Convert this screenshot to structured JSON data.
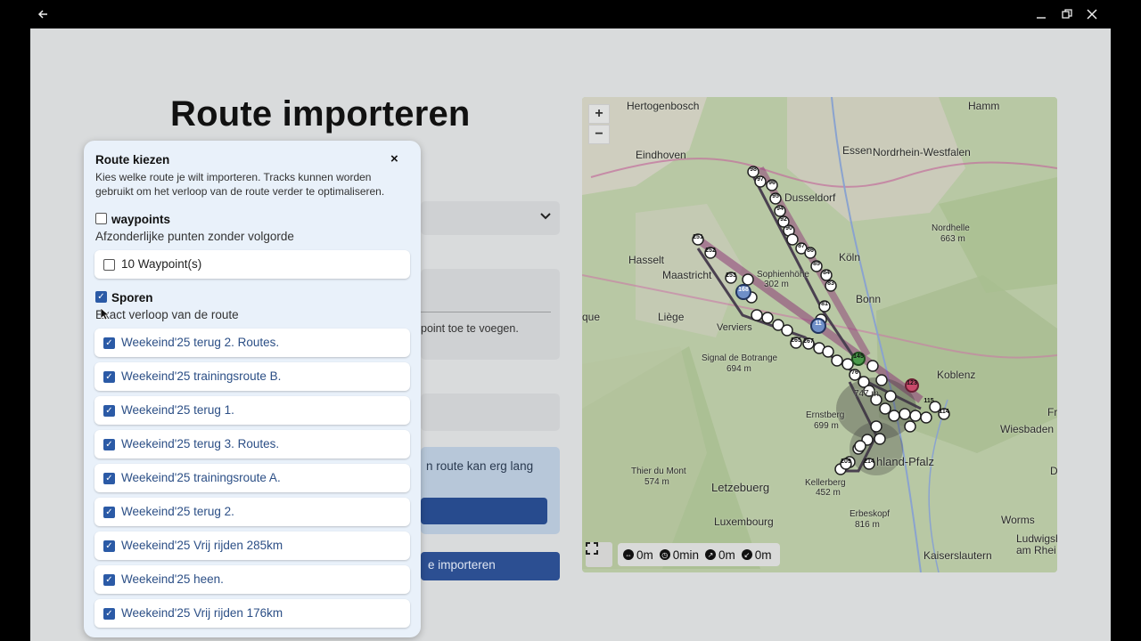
{
  "window": {
    "back_icon": "arrow-left-icon",
    "minimize": "minimize-icon",
    "maximize": "restore-icon",
    "close": "close-icon"
  },
  "page": {
    "title": "Route importeren",
    "bg_hint": "point toe te voegen.",
    "bg_info": "n route kan erg lang",
    "bg_import_label": "e importeren"
  },
  "map": {
    "zoom_in": "+",
    "zoom_out": "−",
    "labels": [
      {
        "text": "Hertogenbosch"
      },
      {
        "text": "Hamm"
      },
      {
        "text": "Eindhoven"
      },
      {
        "text": "Essen"
      },
      {
        "text": "Nordrhein-Westfalen"
      },
      {
        "text": "Dusseldorf"
      },
      {
        "text": "Nordhelle"
      },
      {
        "text": "663 m"
      },
      {
        "text": "Hasselt"
      },
      {
        "text": "Maastricht"
      },
      {
        "text": "Sophienhöhe"
      },
      {
        "text": "302 m"
      },
      {
        "text": "Köln"
      },
      {
        "text": "Bonn"
      },
      {
        "text": "que"
      },
      {
        "text": "Liège"
      },
      {
        "text": "Verviers"
      },
      {
        "text": "Signal de Botrange"
      },
      {
        "text": "694 m"
      },
      {
        "text": "Koblenz"
      },
      {
        "text": "Ernstberg"
      },
      {
        "text": "699 m"
      },
      {
        "text": "747 m"
      },
      {
        "text": "Wiesbaden"
      },
      {
        "text": "Fr"
      },
      {
        "text": "Thier du Mont"
      },
      {
        "text": "574 m"
      },
      {
        "text": "Letzebuerg"
      },
      {
        "text": "Kellerberg"
      },
      {
        "text": "452 m"
      },
      {
        "text": "hland-Pfalz"
      },
      {
        "text": "Da"
      },
      {
        "text": "Luxembourg"
      },
      {
        "text": "Erbeskopf"
      },
      {
        "text": "816 m"
      },
      {
        "text": "Worms"
      },
      {
        "text": "Ludwigsha"
      },
      {
        "text": "am Rhei"
      },
      {
        "text": "Kaiserslautern"
      }
    ],
    "markers": [
      "98",
      "97",
      "96",
      "95",
      "94",
      "92",
      "90",
      "87",
      "86",
      "85",
      "84",
      "83",
      "81",
      "251",
      "252",
      "253",
      "168",
      "11",
      "265",
      "267",
      "145",
      "76",
      "123",
      "115",
      "114",
      "209",
      "214"
    ],
    "stats": [
      {
        "icon": "distance-icon",
        "value": "0m"
      },
      {
        "icon": "clock-icon",
        "value": "0min"
      },
      {
        "icon": "ascent-icon",
        "value": "0m"
      },
      {
        "icon": "descent-icon",
        "value": "0m"
      }
    ]
  },
  "modal": {
    "title": "Route kiezen",
    "close": "×",
    "description": "Kies welke route je wilt importeren. Tracks kunnen worden gebruikt om het verloop van de route verder te optimaliseren.",
    "groups": [
      {
        "label": "waypoints",
        "checked": false,
        "description": "Afzonderlijke punten zonder volgorde",
        "items": [
          {
            "label": "10 Waypoint(s)",
            "checked": false
          }
        ]
      },
      {
        "label": "Sporen",
        "checked": true,
        "description": "Exact verloop van de route",
        "items": [
          {
            "label": "Weekeind'25 terug 2. Routes.",
            "checked": true
          },
          {
            "label": "Weekeind'25 trainingsroute B.",
            "checked": true
          },
          {
            "label": "Weekeind'25 terug 1.",
            "checked": true
          },
          {
            "label": "Weekeind'25 terug 3. Routes.",
            "checked": true
          },
          {
            "label": "Weekeind'25 trainingsroute A.",
            "checked": true
          },
          {
            "label": "Weekeind'25 terug 2.",
            "checked": true
          },
          {
            "label": "Weekeind'25 Vrij rijden 285km",
            "checked": true
          },
          {
            "label": "Weekeind'25 heen.",
            "checked": true
          },
          {
            "label": "Weekeind'25 Vrij rijden 176km",
            "checked": true
          }
        ]
      }
    ]
  }
}
